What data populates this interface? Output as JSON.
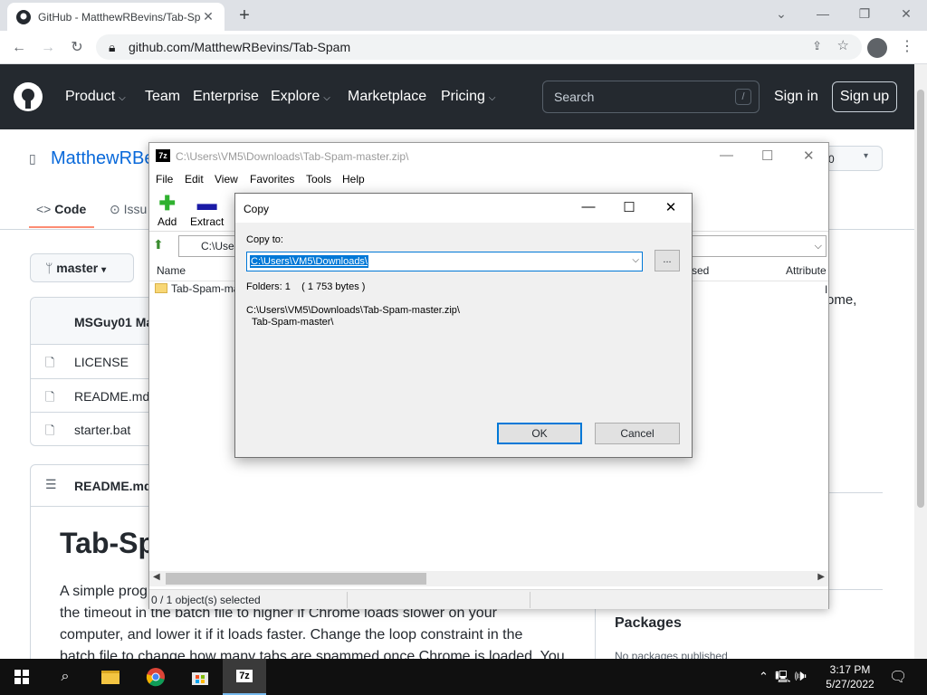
{
  "browser": {
    "tab_title": "GitHub - MatthewRBevins/Tab-Spam",
    "tab_close": "✕",
    "new_tab": "+",
    "url": "github.com/MatthewRBevins/Tab-Spam",
    "win_min": "—",
    "win_restore": "❐",
    "win_close": "✕",
    "tab_search": "⌄"
  },
  "github": {
    "nav": [
      "Product",
      "Team",
      "Enterprise",
      "Explore",
      "Marketplace",
      "Pricing"
    ],
    "search_placeholder": "Search",
    "search_key": "/",
    "sign_in": "Sign in",
    "sign_up": "Sign up"
  },
  "repo": {
    "owner_visible": "MatthewRBe",
    "tabs": {
      "code": "Code",
      "issues": "Issu"
    },
    "branch": "master",
    "commit_author": "MSGuy01 Ma",
    "files": [
      "LICENSE",
      "README.md",
      "starter.bat"
    ],
    "readme_label": "README.md",
    "readme_title": "Tab-Sp",
    "readme_text": [
      "A simple prog",
      "the timeout in the batch file to higher if Chrome loads slower on your",
      "computer, and lower it if it loads faster. Change the loop constraint in the",
      "batch file to change how many tabs are spammed once Chrome is loaded. You"
    ],
    "about_snippet": "ome,",
    "star_count": "0",
    "packages_title": "Packages",
    "packages_empty": "No packages published"
  },
  "sevenzip": {
    "title": "C:\\Users\\VM5\\Downloads\\Tab-Spam-master.zip\\",
    "app_icon": "7z",
    "menu": [
      "File",
      "Edit",
      "View",
      "Favorites",
      "Tools",
      "Help"
    ],
    "toolbar": [
      {
        "label": "Add",
        "icon": "plus-icon",
        "color": "#2fb12f"
      },
      {
        "label": "Extract",
        "icon": "minus-icon",
        "color": "#1a1aa6"
      }
    ],
    "path": "C:\\User",
    "columns": [
      "Name",
      "sed",
      "Attribute"
    ],
    "item": "Tab-Spam-ma",
    "attr_partial": "I",
    "status": "0 / 1 object(s) selected"
  },
  "copy_dialog": {
    "title": "Copy",
    "copy_to_label": "Copy to:",
    "destination": "C:\\Users\\VM5\\Downloads\\",
    "browse": "...",
    "folder_info": "Folders: 1    ( 1 753 bytes )",
    "source_path": "C:\\Users\\VM5\\Downloads\\Tab-Spam-master.zip\\",
    "source_item": "Tab-Spam-master\\",
    "ok": "OK",
    "cancel": "Cancel",
    "accent_color": "#0078d7"
  },
  "taskbar": {
    "time": "3:17 PM",
    "date": "5/27/2022",
    "apps": [
      "windows-start-icon",
      "search-icon",
      "file-explorer-icon",
      "chrome-icon",
      "store-icon",
      "7zip-icon"
    ]
  }
}
